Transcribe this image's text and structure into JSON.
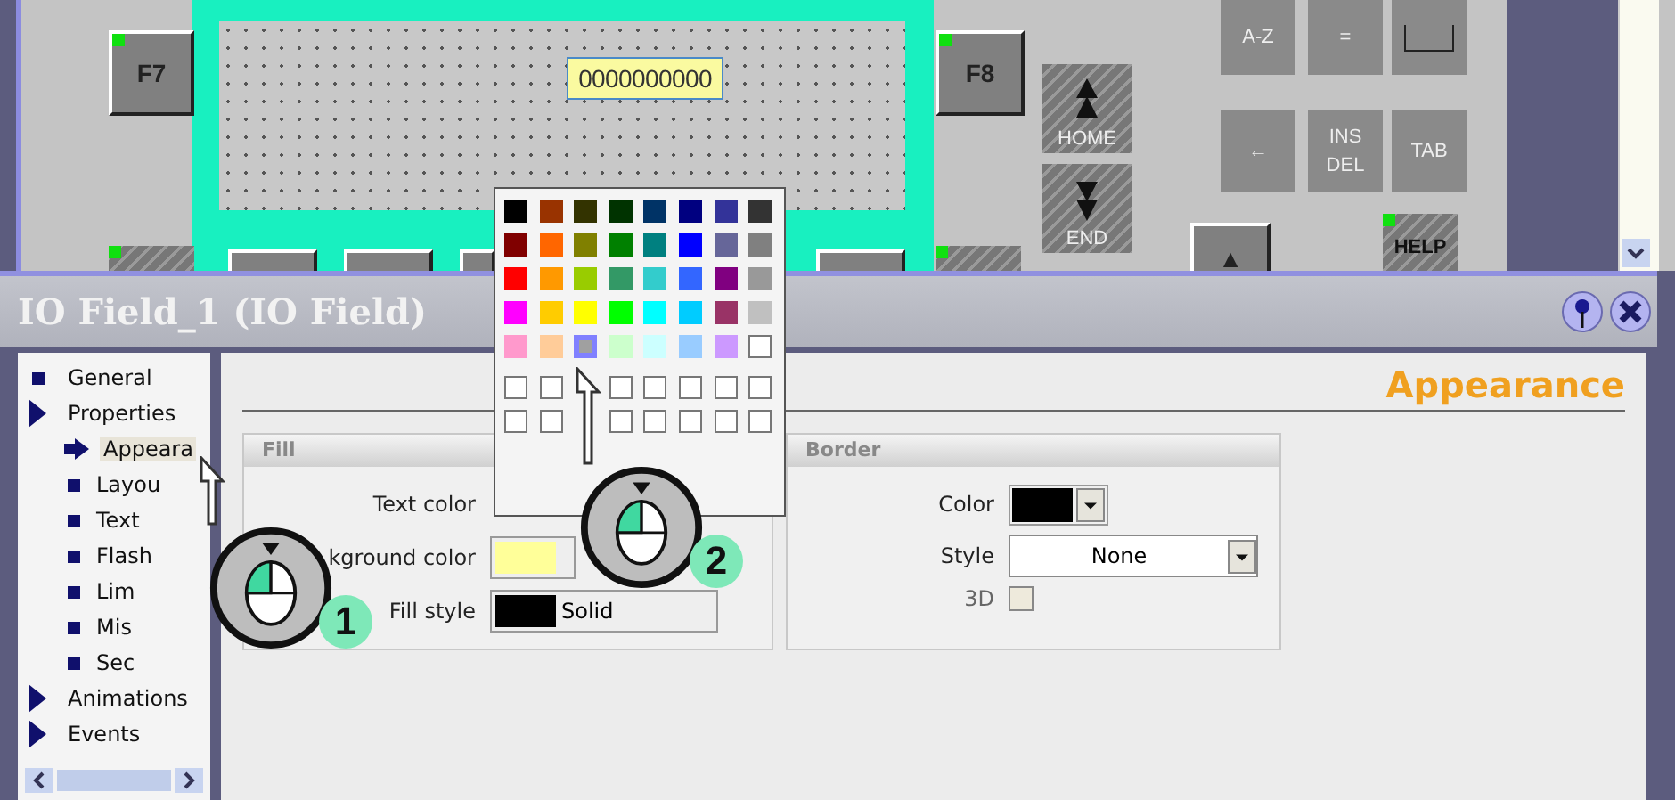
{
  "canvas": {
    "output_field": {
      "value": "0000000000"
    },
    "keys": [
      {
        "kind": "raised",
        "lines": [
          "F7"
        ],
        "marked": true
      },
      {
        "kind": "raised",
        "lines": [
          "F8"
        ],
        "marked": true
      },
      {
        "kind": "hatched-up",
        "lines": [
          "HOME"
        ],
        "marked": false
      },
      {
        "kind": "hatched-down",
        "lines": [
          "END"
        ],
        "marked": false
      },
      {
        "kind": "flat",
        "lines": [
          "A-Z"
        ],
        "marked": false
      },
      {
        "kind": "flat",
        "lines": [
          "="
        ],
        "marked": false
      },
      {
        "kind": "outline",
        "marked": false
      },
      {
        "kind": "flat",
        "lines": [
          "←"
        ],
        "marked": false
      },
      {
        "kind": "flat",
        "lines": [
          "INS",
          "DEL"
        ],
        "marked": false
      },
      {
        "kind": "flat",
        "lines": [
          "TAB"
        ],
        "marked": false
      },
      {
        "kind": "raised",
        "lines": [
          "▲"
        ],
        "marked": false
      },
      {
        "kind": "hatched",
        "lines": [
          "HELP"
        ],
        "marked": true
      },
      {
        "kind": "hatched",
        "marked": true
      },
      {
        "kind": "raised",
        "marked": false
      },
      {
        "kind": "raised",
        "marked": false
      },
      {
        "kind": "raised",
        "marked": false
      },
      {
        "kind": "raised",
        "marked": false
      },
      {
        "kind": "hatched",
        "marked": true
      }
    ]
  },
  "inspector": {
    "title": "IO Field_1 (IO Field)",
    "tree": [
      {
        "label": "General",
        "kind": "leaf",
        "selected": false
      },
      {
        "label": "Properties",
        "kind": "folder",
        "selected": false,
        "children": [
          {
            "label": "Appeara",
            "kind": "leaf",
            "selected": true
          },
          {
            "label": "Layou",
            "kind": "leaf",
            "selected": false
          },
          {
            "label": "Text",
            "kind": "leaf",
            "selected": false
          },
          {
            "label": "Flash",
            "kind": "leaf",
            "selected": false
          },
          {
            "label": "Lim",
            "kind": "leaf",
            "selected": false
          },
          {
            "label": "Mis",
            "kind": "leaf",
            "selected": false
          },
          {
            "label": "Sec",
            "kind": "leaf",
            "selected": false
          }
        ]
      },
      {
        "label": "Animations",
        "kind": "folder",
        "selected": false
      },
      {
        "label": "Events",
        "kind": "folder",
        "selected": false
      }
    ],
    "section_title": "Appearance",
    "fill": {
      "title": "Fill",
      "rows": [
        {
          "label": "Text color",
          "kind": "hidden"
        },
        {
          "label": "kground color",
          "kind": "color",
          "color": "#ffff99"
        },
        {
          "label": "Fill style",
          "kind": "style",
          "color": "#000000",
          "value": "Solid"
        }
      ]
    },
    "border": {
      "title": "Border",
      "color_label": "Color",
      "color": "#000000",
      "style_label": "Style",
      "style_value": "None",
      "three_d_label": "3D",
      "three_d_checked": false
    }
  },
  "palette": {
    "swatches": [
      {
        "color": "#000000",
        "selected": false
      },
      {
        "color": "#993300",
        "selected": false
      },
      {
        "color": "#333300",
        "selected": false
      },
      {
        "color": "#003300",
        "selected": false
      },
      {
        "color": "#003366",
        "selected": false
      },
      {
        "color": "#000080",
        "selected": false
      },
      {
        "color": "#333399",
        "selected": false
      },
      {
        "color": "#333333",
        "selected": false
      },
      {
        "color": "#800000",
        "selected": false
      },
      {
        "color": "#ff6600",
        "selected": false
      },
      {
        "color": "#808000",
        "selected": false
      },
      {
        "color": "#008000",
        "selected": false
      },
      {
        "color": "#008080",
        "selected": false
      },
      {
        "color": "#0000ff",
        "selected": false
      },
      {
        "color": "#666699",
        "selected": false
      },
      {
        "color": "#808080",
        "selected": false
      },
      {
        "color": "#ff0000",
        "selected": false
      },
      {
        "color": "#ff9900",
        "selected": false
      },
      {
        "color": "#99cc00",
        "selected": false
      },
      {
        "color": "#339966",
        "selected": false
      },
      {
        "color": "#33cccc",
        "selected": false
      },
      {
        "color": "#3366ff",
        "selected": false
      },
      {
        "color": "#800080",
        "selected": false
      },
      {
        "color": "#999999",
        "selected": false
      },
      {
        "color": "#ff00ff",
        "selected": false
      },
      {
        "color": "#ffcc00",
        "selected": false
      },
      {
        "color": "#ffff00",
        "selected": false
      },
      {
        "color": "#00ff00",
        "selected": false
      },
      {
        "color": "#00ffff",
        "selected": false
      },
      {
        "color": "#00ccff",
        "selected": false
      },
      {
        "color": "#993366",
        "selected": false
      },
      {
        "color": "#c0c0c0",
        "selected": false
      },
      {
        "color": "#ff99cc",
        "selected": false
      },
      {
        "color": "#ffcc99",
        "selected": false
      },
      {
        "color": "#a0a0a0",
        "selected": true
      },
      {
        "color": "#ccffcc",
        "selected": false
      },
      {
        "color": "#ccffff",
        "selected": false
      },
      {
        "color": "#99ccff",
        "selected": false
      },
      {
        "color": "#cc99ff",
        "selected": false
      },
      {
        "color": "#ffffff",
        "selected": false
      }
    ],
    "custom_slots": [
      {
        "selected": false
      },
      {
        "selected": false
      },
      {
        "selected": false
      },
      {
        "selected": false
      },
      {
        "selected": false
      },
      {
        "selected": false
      },
      {
        "selected": false
      },
      {
        "selected": false
      },
      {
        "selected": false
      },
      {
        "selected": false
      },
      {
        "selected": false
      },
      {
        "selected": false
      },
      {
        "selected": false
      },
      {
        "selected": false
      }
    ]
  },
  "callouts": [
    {
      "number": "1"
    },
    {
      "number": "2"
    }
  ]
}
